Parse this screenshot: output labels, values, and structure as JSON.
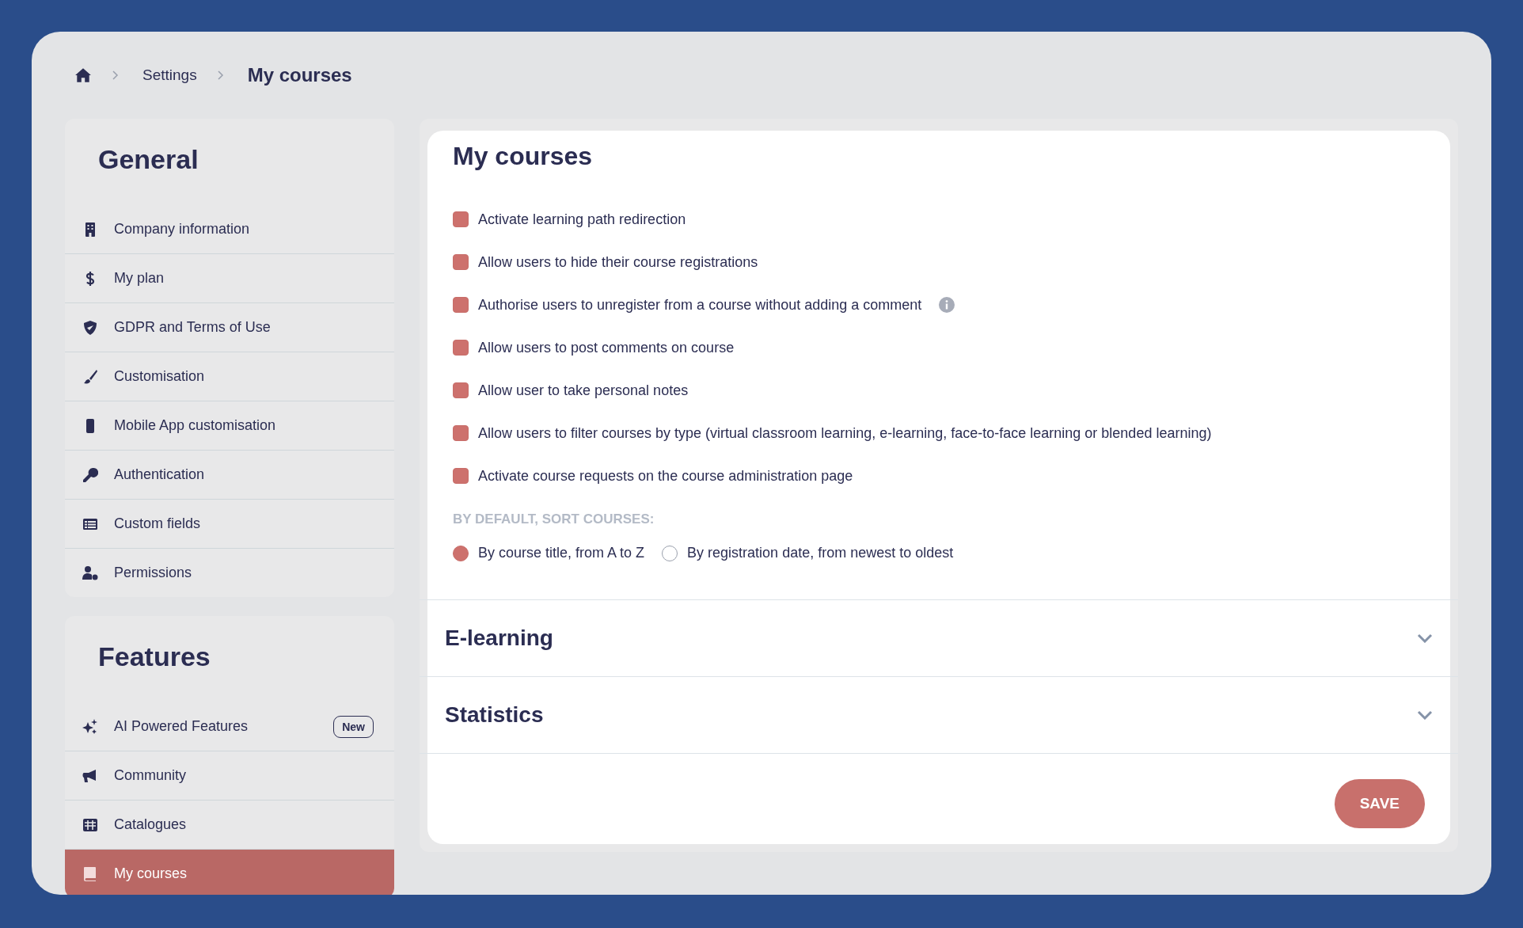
{
  "breadcrumb": {
    "items": [
      "Settings"
    ],
    "current": "My courses"
  },
  "sidebar": {
    "sections": [
      {
        "title": "General",
        "items": [
          {
            "label": "Company information",
            "kind": "building",
            "selected": false
          },
          {
            "label": "My plan",
            "kind": "dollar",
            "selected": false
          },
          {
            "label": "GDPR and Terms of Use",
            "kind": "shield",
            "selected": false
          },
          {
            "label": "Customisation",
            "kind": "brush",
            "selected": false
          },
          {
            "label": "Mobile App customisation",
            "kind": "phone",
            "selected": false
          },
          {
            "label": "Authentication",
            "kind": "key",
            "selected": false
          },
          {
            "label": "Custom fields",
            "kind": "list",
            "selected": false
          },
          {
            "label": "Permissions",
            "kind": "usergear",
            "selected": false
          }
        ]
      },
      {
        "title": "Features",
        "items": [
          {
            "label": "AI Powered Features",
            "kind": "sparkles",
            "selected": false,
            "badge": "New"
          },
          {
            "label": "Community",
            "kind": "megaphone",
            "selected": false
          },
          {
            "label": "Catalogues",
            "kind": "grid",
            "selected": false
          },
          {
            "label": "My courses",
            "kind": "book",
            "selected": true
          }
        ]
      }
    ]
  },
  "main": {
    "title": "My courses",
    "options": [
      {
        "label": "Activate learning path redirection",
        "checked": true
      },
      {
        "label": "Allow users to hide their course registrations",
        "checked": true
      },
      {
        "label": "Authorise users to unregister from a course without adding a comment",
        "checked": true,
        "info": true
      },
      {
        "label": "Allow users to post comments on course",
        "checked": true
      },
      {
        "label": "Allow user to take personal notes",
        "checked": true
      },
      {
        "label": "Allow users to filter courses by type (virtual classroom learning, e-learning, face-to-face learning or blended learning)",
        "checked": true
      },
      {
        "label": "Activate course requests on the course administration page",
        "checked": true
      }
    ],
    "sort_label": "BY DEFAULT, SORT COURSES:",
    "sort_options": [
      {
        "label": "By course title, from A to Z",
        "selected": true
      },
      {
        "label": "By registration date, from newest to oldest",
        "selected": false
      }
    ],
    "sections": [
      {
        "title": "E-learning",
        "expanded": false
      },
      {
        "title": "Statistics",
        "expanded": false
      }
    ],
    "save_button": "SAVE"
  }
}
